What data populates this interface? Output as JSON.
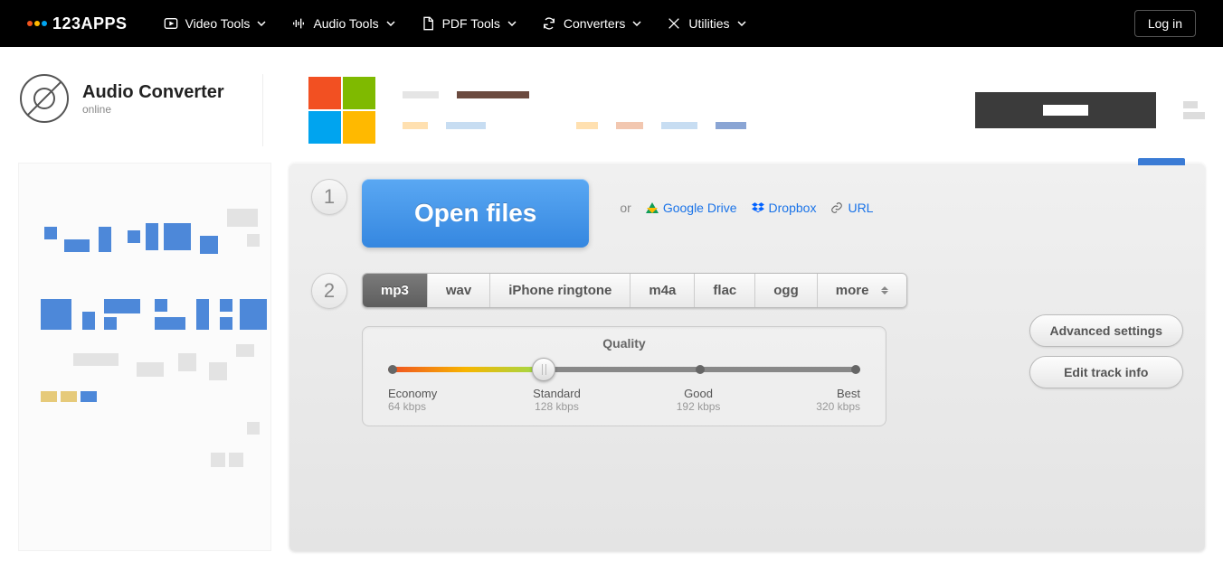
{
  "brand": "123APPS",
  "nav": {
    "video": "Video Tools",
    "audio": "Audio Tools",
    "pdf": "PDF Tools",
    "converters": "Converters",
    "utilities": "Utilities"
  },
  "login": "Log in",
  "app": {
    "title": "Audio Converter",
    "subtitle": "online"
  },
  "step1": {
    "open": "Open files",
    "or": "or",
    "gdrive": "Google Drive",
    "dropbox": "Dropbox",
    "url": "URL"
  },
  "formats": {
    "mp3": "mp3",
    "wav": "wav",
    "iphone": "iPhone ringtone",
    "m4a": "m4a",
    "flac": "flac",
    "ogg": "ogg",
    "more": "more"
  },
  "quality": {
    "title": "Quality",
    "levels": [
      {
        "name": "Economy",
        "rate": "64 kbps"
      },
      {
        "name": "Standard",
        "rate": "128 kbps"
      },
      {
        "name": "Good",
        "rate": "192 kbps"
      },
      {
        "name": "Best",
        "rate": "320 kbps"
      }
    ]
  },
  "buttons": {
    "adv": "Advanced settings",
    "track": "Edit track info"
  }
}
